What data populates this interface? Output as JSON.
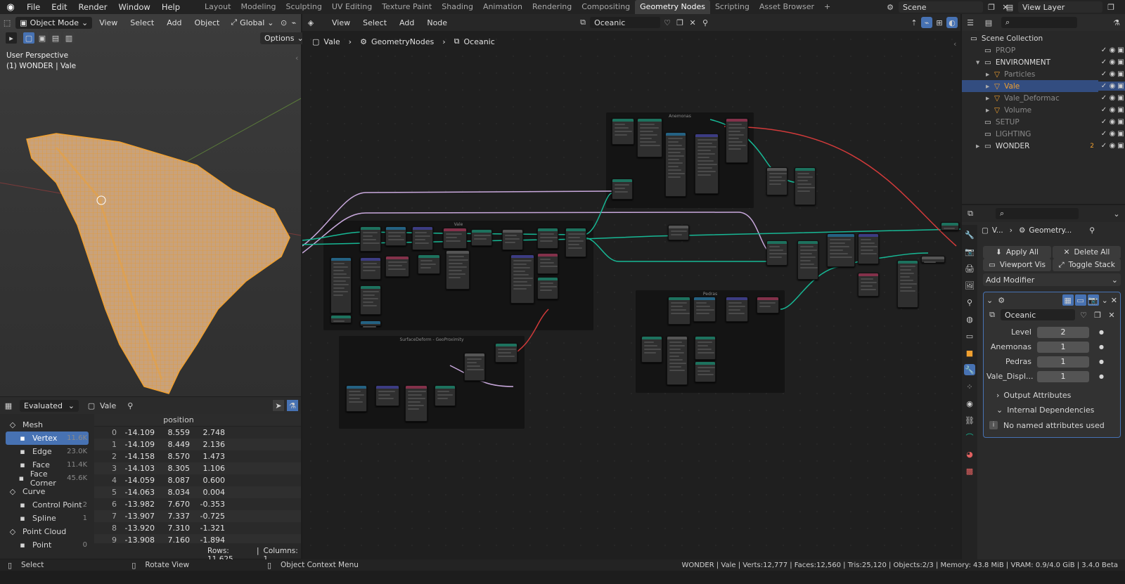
{
  "topbar": {
    "menus": [
      "File",
      "Edit",
      "Render",
      "Window",
      "Help"
    ],
    "workspaces": [
      "Layout",
      "Modeling",
      "Sculpting",
      "UV Editing",
      "Texture Paint",
      "Shading",
      "Animation",
      "Rendering",
      "Compositing",
      "Geometry Nodes",
      "Scripting",
      "Asset Browser"
    ],
    "active_workspace": "Geometry Nodes",
    "add_tab": "+",
    "scene": "Scene",
    "view_layer": "View Layer"
  },
  "viewport": {
    "mode": "Object Mode",
    "menus": [
      "View",
      "Select",
      "Add",
      "Object"
    ],
    "transform": "Global",
    "options": "Options",
    "overlay_line1": "User Perspective",
    "overlay_line2": "(1) WONDER | Vale"
  },
  "spreadsheet": {
    "evaluated": "Evaluated",
    "object": "Vale",
    "column_header": "position",
    "tree": [
      {
        "label": "Mesh",
        "count": "",
        "kind": "group",
        "icon": "mesh-icon"
      },
      {
        "label": "Vertex",
        "count": "11.6K",
        "kind": "item",
        "selected": true,
        "icon": "vertex-icon"
      },
      {
        "label": "Edge",
        "count": "23.0K",
        "kind": "item",
        "icon": "edge-icon"
      },
      {
        "label": "Face",
        "count": "11.4K",
        "kind": "item",
        "icon": "face-icon"
      },
      {
        "label": "Face Corner",
        "count": "45.6K",
        "kind": "item",
        "icon": "face-corner-icon"
      },
      {
        "label": "Curve",
        "count": "",
        "kind": "group",
        "icon": "curve-icon"
      },
      {
        "label": "Control Point",
        "count": "2",
        "kind": "item",
        "icon": "control-point-icon"
      },
      {
        "label": "Spline",
        "count": "1",
        "kind": "item",
        "icon": "spline-icon"
      },
      {
        "label": "Point Cloud",
        "count": "",
        "kind": "group",
        "icon": "point-cloud-icon"
      },
      {
        "label": "Point",
        "count": "0",
        "kind": "item",
        "icon": "point-icon"
      }
    ],
    "rows": [
      [
        "0",
        "-14.109",
        "8.559",
        "2.748"
      ],
      [
        "1",
        "-14.109",
        "8.449",
        "2.136"
      ],
      [
        "2",
        "-14.158",
        "8.570",
        "1.473"
      ],
      [
        "3",
        "-14.103",
        "8.305",
        "1.106"
      ],
      [
        "4",
        "-14.059",
        "8.087",
        "0.600"
      ],
      [
        "5",
        "-14.063",
        "8.034",
        "0.004"
      ],
      [
        "6",
        "-13.982",
        "7.670",
        "-0.353"
      ],
      [
        "7",
        "-13.907",
        "7.337",
        "-0.725"
      ],
      [
        "8",
        "-13.920",
        "7.310",
        "-1.321"
      ],
      [
        "9",
        "-13.908",
        "7.160",
        "-1.894"
      ]
    ],
    "footer_rows": "Rows: 11,625",
    "footer_sep": "|",
    "footer_cols": "Columns: 1"
  },
  "node_editor": {
    "menus": [
      "View",
      "Select",
      "Add",
      "Node"
    ],
    "tree_name": "Oceanic",
    "breadcrumb": [
      "Vale",
      "GeometryNodes",
      "Oceanic"
    ],
    "frames": [
      "Anemonas",
      "Vale",
      "SurfaceDeform - GeoProximity",
      "Pedras"
    ]
  },
  "outliner": {
    "root": "Scene Collection",
    "items": [
      {
        "label": "PROP",
        "indent": 1,
        "dim": true,
        "expand": ""
      },
      {
        "label": "ENVIRONMENT",
        "indent": 1,
        "dim": false,
        "expand": "▾"
      },
      {
        "label": "Particles",
        "indent": 2,
        "dim": true,
        "expand": "▸"
      },
      {
        "label": "Vale",
        "indent": 2,
        "dim": false,
        "selected": true,
        "expand": "▸"
      },
      {
        "label": "Vale_Deformac",
        "indent": 2,
        "dim": true,
        "expand": "▸"
      },
      {
        "label": "Volume",
        "indent": 2,
        "dim": true,
        "expand": "▸"
      },
      {
        "label": "SETUP",
        "indent": 1,
        "dim": true,
        "expand": ""
      },
      {
        "label": "LIGHTING",
        "indent": 1,
        "dim": true,
        "expand": ""
      },
      {
        "label": "WONDER",
        "indent": 1,
        "dim": false,
        "expand": "▸"
      }
    ],
    "wonder_badge": "2"
  },
  "properties": {
    "breadcrumb_obj": "V...",
    "breadcrumb_mod": "Geometry...",
    "apply_all": "Apply All",
    "delete_all": "Delete All",
    "viewport_vis": "Viewport Vis",
    "toggle_stack": "Toggle Stack",
    "add_modifier": "Add Modifier",
    "modifier_name": "Oceanic",
    "inputs": [
      {
        "label": "Level",
        "value": "2"
      },
      {
        "label": "Anemonas",
        "value": "1"
      },
      {
        "label": "Pedras",
        "value": "1"
      },
      {
        "label": "Vale_Displ...",
        "value": "1"
      }
    ],
    "output_attributes": "Output Attributes",
    "internal_dependencies": "Internal Dependencies",
    "no_named": "No named attributes used"
  },
  "statusbar": {
    "select": "Select",
    "rotate": "Rotate View",
    "context": "Object Context Menu",
    "stats": "WONDER | Vale | Verts:12,777 | Faces:12,560 | Tris:25,120 | Objects:2/3 | Memory: 43.8 MiB | VRAM: 0.9/4.0 GiB | 3.4.0 Beta"
  },
  "colors": {
    "accent": "#4772b3",
    "orange": "#f0a030",
    "geo_link": "#17b895",
    "shader_link": "#c8a8dc",
    "red_link": "#d23a3a"
  }
}
